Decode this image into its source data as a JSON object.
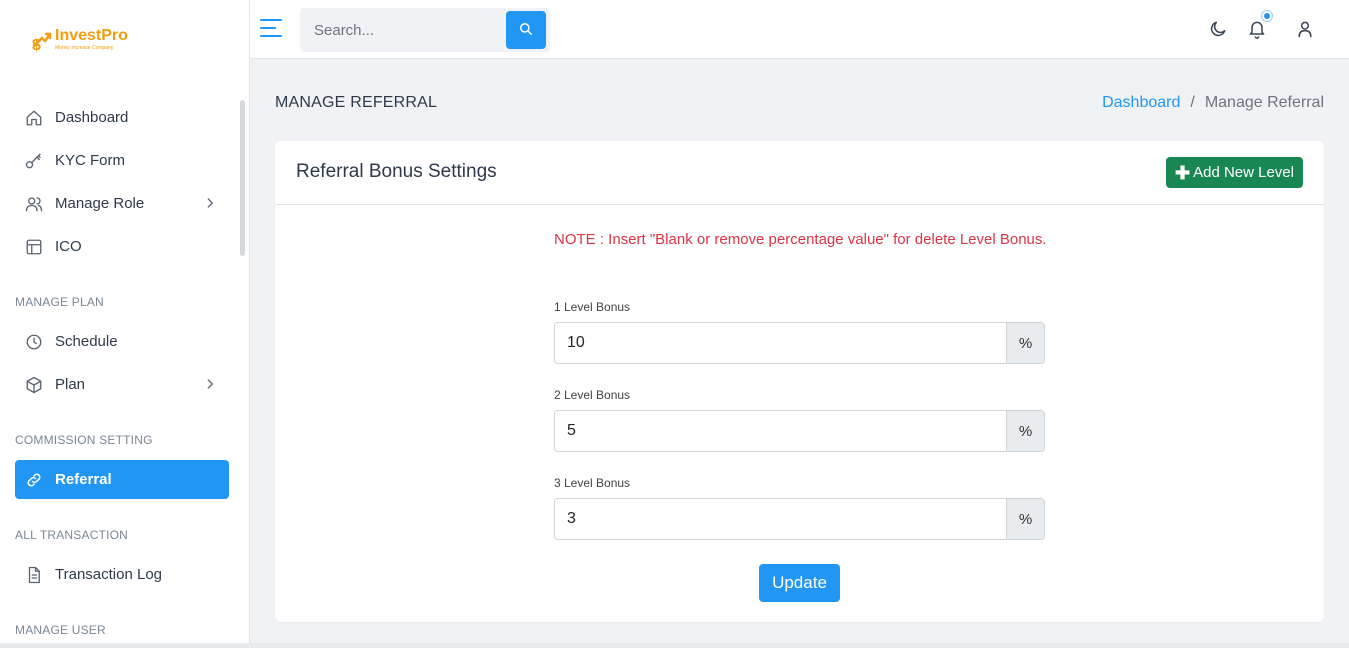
{
  "brand": {
    "name": "InvestPro",
    "tagline": "Money Increase Company",
    "accent": "#f39c12"
  },
  "colors": {
    "primary": "#2196f3",
    "success": "#198754",
    "danger": "#dc3545"
  },
  "sidebar": {
    "items": [
      {
        "label": "Dashboard",
        "icon": "home-icon"
      },
      {
        "label": "KYC Form",
        "icon": "key-icon"
      },
      {
        "label": "Manage Role",
        "icon": "users-icon",
        "has_submenu": true
      },
      {
        "label": "ICO",
        "icon": "layout-icon"
      }
    ],
    "sections": [
      {
        "title": "MANAGE PLAN",
        "items": [
          {
            "label": "Schedule",
            "icon": "clock-icon"
          },
          {
            "label": "Plan",
            "icon": "box-icon",
            "has_submenu": true
          }
        ]
      },
      {
        "title": "COMMISSION SETTING",
        "items": [
          {
            "label": "Referral",
            "icon": "link-icon",
            "active": true
          }
        ]
      },
      {
        "title": "ALL TRANSACTION",
        "items": [
          {
            "label": "Transaction Log",
            "icon": "document-icon"
          }
        ]
      },
      {
        "title": "MANAGE USER",
        "items": []
      }
    ]
  },
  "topbar": {
    "search": {
      "placeholder": "Search...",
      "value": ""
    },
    "icons": [
      "menu-icon",
      "search-icon",
      "moon-icon",
      "bell-icon",
      "user-icon"
    ]
  },
  "page": {
    "title": "MANAGE REFERRAL",
    "breadcrumb": {
      "link": "Dashboard",
      "separator": "/",
      "current": "Manage Referral"
    }
  },
  "card": {
    "title": "Referral Bonus Settings",
    "add_button": "Add New Level",
    "note": "NOTE : Insert \"Blank or remove percentage value\" for delete Level Bonus.",
    "levels": [
      {
        "label": "1 Level Bonus",
        "value": "10",
        "suffix": "%"
      },
      {
        "label": "2 Level Bonus",
        "value": "5",
        "suffix": "%"
      },
      {
        "label": "3 Level Bonus",
        "value": "3",
        "suffix": "%"
      }
    ],
    "update_button": "Update"
  }
}
